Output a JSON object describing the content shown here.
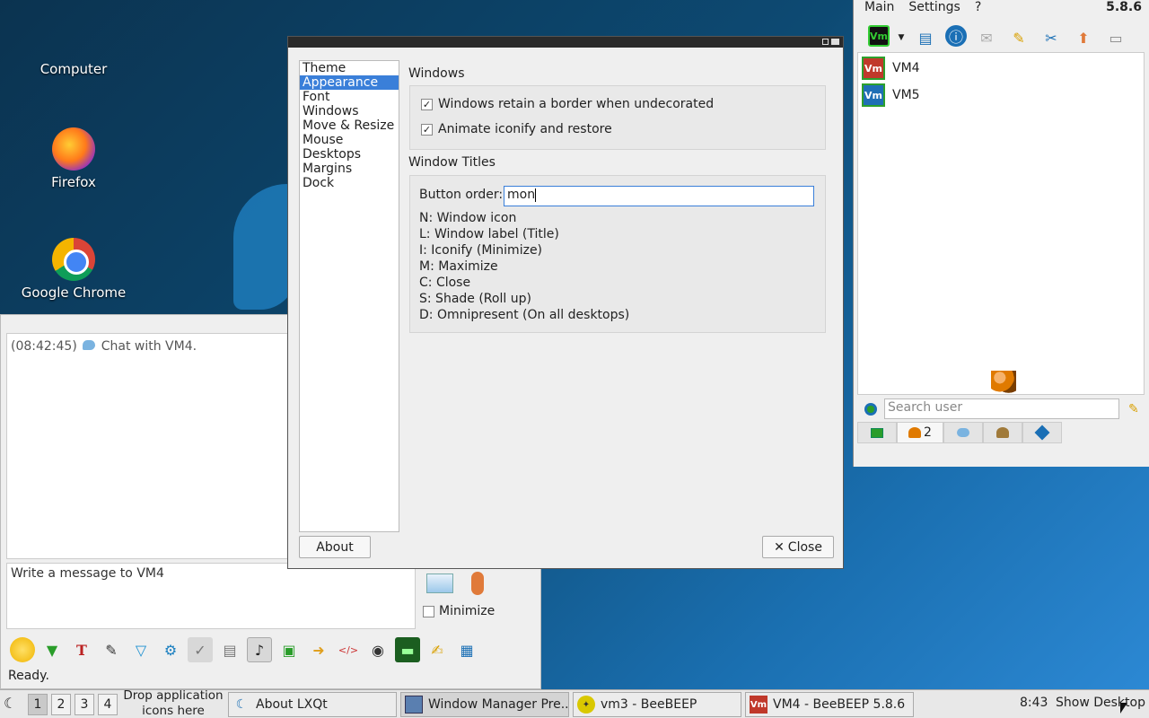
{
  "desktop": {
    "icons": [
      {
        "label": "Computer"
      },
      {
        "label": "Firefox"
      },
      {
        "label": "Google Chrome"
      }
    ]
  },
  "chat": {
    "log_time": "(08:42:45)",
    "log_text": "Chat with VM4.",
    "input_placeholder": "Write a message to VM4",
    "minimize_label": "Minimize",
    "status": "Ready."
  },
  "dialog": {
    "nav": [
      "Theme",
      "Appearance",
      "Font",
      "Windows",
      "Move & Resize",
      "Mouse",
      "Desktops",
      "Margins",
      "Dock"
    ],
    "nav_selected": 1,
    "windows_section": "Windows",
    "opt_border": "Windows retain a border when undecorated",
    "opt_animate": "Animate iconify and restore",
    "titles_section": "Window Titles",
    "button_order_label": "Button order:",
    "button_order_value": "mon",
    "legend": [
      "N: Window icon",
      "L: Window label (Title)",
      "I: Iconify (Minimize)",
      "M: Maximize",
      "C: Close",
      "S: Shade (Roll up)",
      "D: Omnipresent (On all desktops)"
    ],
    "about_label": "About",
    "close_label": "Close"
  },
  "beebeep": {
    "menu": [
      "Main",
      "Settings",
      "?"
    ],
    "version": "5.8.6",
    "users": [
      {
        "name": "VM4",
        "color": "#c0392b"
      },
      {
        "name": "VM5",
        "color": "#1f6fb5"
      }
    ],
    "search_placeholder": "Search user",
    "tab_count": "2"
  },
  "taskbar": {
    "desktops": [
      "1",
      "2",
      "3",
      "4"
    ],
    "drop_hint": "Drop application icons here",
    "tasks": [
      {
        "label": "About LXQt"
      },
      {
        "label": "Window Manager Pre..."
      },
      {
        "label": "vm3 - BeeBEEP"
      },
      {
        "label": "VM4 - BeeBEEP 5.8.6"
      }
    ],
    "clock": "8:43",
    "show_desktop": "Show Desktop"
  },
  "colors": {
    "selection": "#3a7fd9",
    "vm_badge": "#c0392b"
  }
}
